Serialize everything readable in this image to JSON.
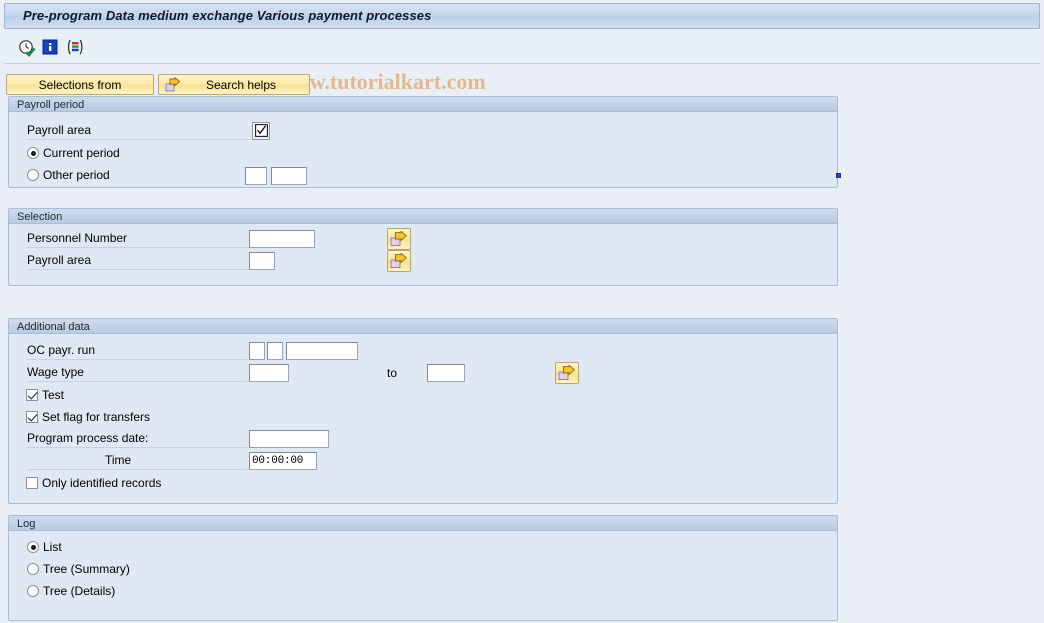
{
  "window": {
    "title": "Pre-program Data medium exchange Various payment processes"
  },
  "toolbar": {
    "icons": [
      {
        "name": "execute-clock-icon",
        "label": "Execute"
      },
      {
        "name": "information-icon",
        "label": "Information"
      },
      {
        "name": "variant-list-icon",
        "label": "Get variant"
      }
    ]
  },
  "watermark": {
    "text": "© www.tutorialkart.com",
    "color": "#e6b583"
  },
  "buttons": {
    "selections_from": "Selections from",
    "search_helps": "Search helps"
  },
  "panels": {
    "payroll_period": {
      "title": "Payroll period",
      "payroll_area_label": "Payroll area",
      "payroll_area_value": "",
      "period_options": [
        {
          "label": "Current period",
          "selected": true
        },
        {
          "label": "Other period",
          "selected": false
        }
      ],
      "other_period_value_1": "",
      "other_period_value_2": ""
    },
    "selection": {
      "title": "Selection",
      "fields": [
        {
          "label": "Personnel Number",
          "value": ""
        },
        {
          "label": "Payroll area",
          "value": ""
        }
      ]
    },
    "additional_data": {
      "title": "Additional data",
      "oc_payr_run_label": "OC payr. run",
      "oc_payr_run_value_1": "",
      "oc_payr_run_value_2": "",
      "oc_payr_run_value_3": "",
      "wage_type_label": "Wage type",
      "wage_type_from": "",
      "wage_type_to_label": "to",
      "wage_type_to": "",
      "test_label": "Test",
      "test_checked": true,
      "set_flag_label": "Set flag for transfers",
      "set_flag_checked": true,
      "program_process_date_label": "Program process date:",
      "program_process_date_value": "",
      "time_label": "Time",
      "time_value": "00:00:00",
      "only_identified_label": "Only identified records",
      "only_identified_checked": false
    },
    "log": {
      "title": "Log",
      "options": [
        {
          "label": "List",
          "selected": true
        },
        {
          "label": "Tree (Summary)",
          "selected": false
        },
        {
          "label": "Tree (Details)",
          "selected": false
        }
      ]
    }
  }
}
